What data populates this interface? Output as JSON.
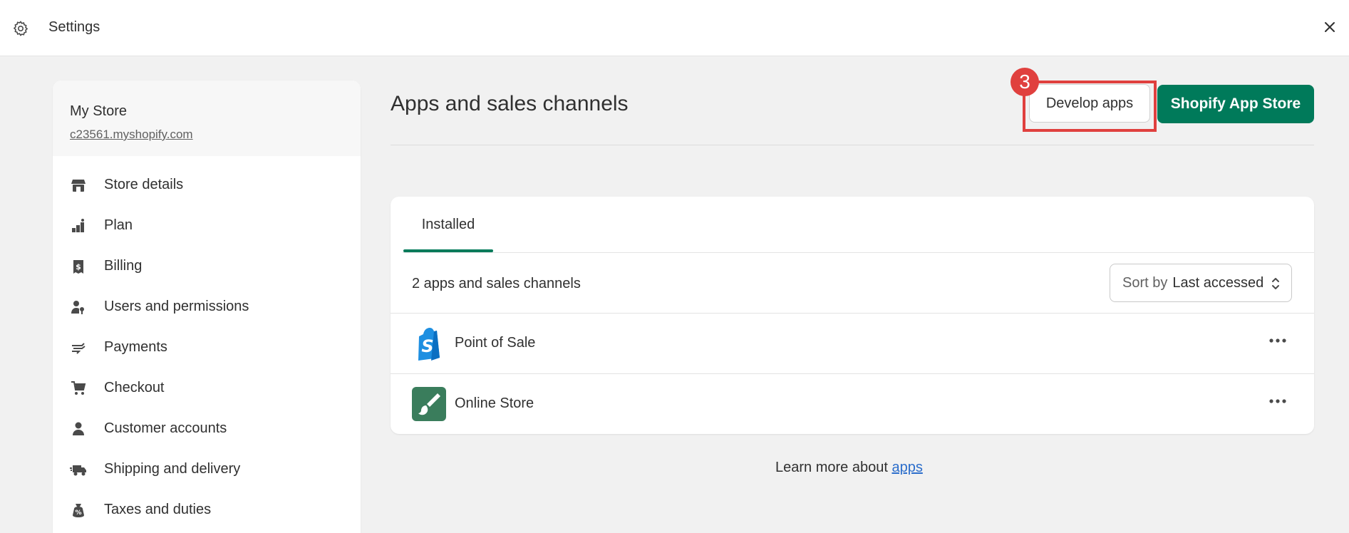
{
  "topbar": {
    "title": "Settings"
  },
  "sidebar": {
    "store_name": "My Store",
    "store_domain": "c23561.myshopify.com",
    "items": [
      {
        "label": "Store details",
        "icon": "store-icon"
      },
      {
        "label": "Plan",
        "icon": "plan-icon"
      },
      {
        "label": "Billing",
        "icon": "receipt-icon"
      },
      {
        "label": "Users and permissions",
        "icon": "user-key-icon"
      },
      {
        "label": "Payments",
        "icon": "hand-money-icon"
      },
      {
        "label": "Checkout",
        "icon": "cart-icon"
      },
      {
        "label": "Customer accounts",
        "icon": "person-icon"
      },
      {
        "label": "Shipping and delivery",
        "icon": "truck-icon"
      },
      {
        "label": "Taxes and duties",
        "icon": "tax-bag-icon"
      }
    ]
  },
  "main": {
    "title": "Apps and sales channels",
    "develop_apps_label": "Develop apps",
    "step_badge": "3",
    "app_store_label": "Shopify App Store",
    "tab_installed": "Installed",
    "count_text": "2 apps and sales channels",
    "sort_prefix": "Sort by",
    "sort_value": "Last accessed",
    "apps": [
      {
        "name": "Point of Sale",
        "icon": "shopify-bag-icon"
      },
      {
        "name": "Online Store",
        "icon": "paintbrush-icon"
      }
    ],
    "learn_prefix": "Learn more about",
    "learn_link": "apps"
  },
  "colors": {
    "accent_green": "#007a5a",
    "highlight_red": "#e0403e",
    "link_blue": "#2c6ecb",
    "background": "#f1f1f1"
  }
}
